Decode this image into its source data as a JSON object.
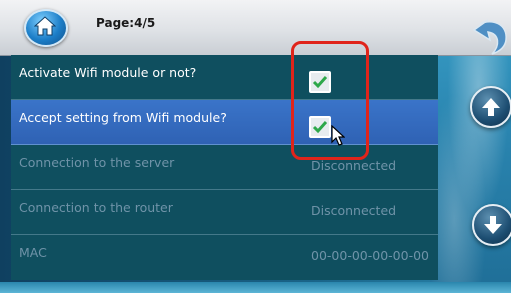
{
  "header": {
    "page_label": "Page:4/5"
  },
  "icons": {
    "home": "home-icon",
    "back": "back-arrow-icon",
    "up": "arrow-up-icon",
    "down": "arrow-down-icon",
    "check": "check-icon",
    "cursor": "mouse-cursor-icon"
  },
  "settings": {
    "rows": [
      {
        "label": "Activate Wifi module or not?",
        "checked": true
      },
      {
        "label": "Accept setting from Wifi module?",
        "checked": true
      },
      {
        "label": "Connection to the server",
        "value": "Disconnected"
      },
      {
        "label": "Connection to the router",
        "value": "Disconnected"
      },
      {
        "label": "MAC",
        "value": "00-00-00-00-00-00"
      }
    ]
  },
  "colors": {
    "highlight": "#e0241b",
    "selected_row": "#3a74c9",
    "check": "#2ea84a"
  }
}
